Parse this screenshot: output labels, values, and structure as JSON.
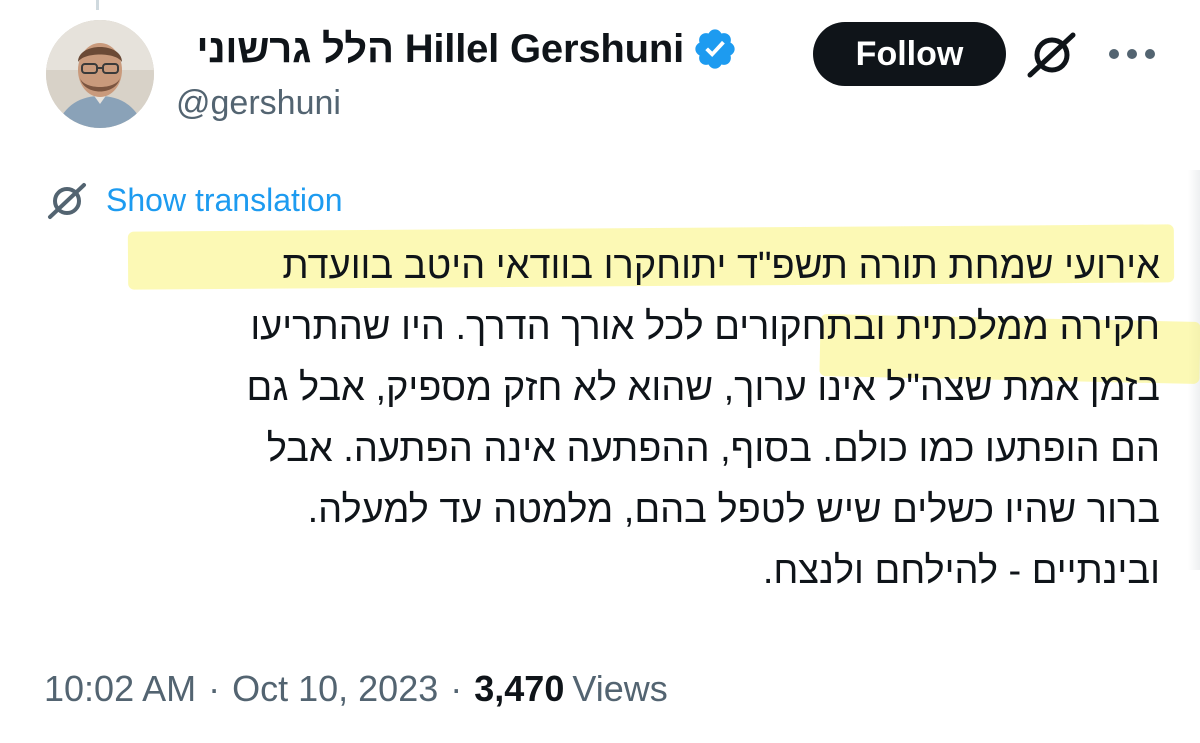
{
  "author": {
    "display_name": "הלל גרשוני Hillel Gershuni",
    "handle": "@gershuni",
    "verified": true,
    "avatar_icon": "person-photo"
  },
  "actions": {
    "follow_label": "Follow",
    "grok_icon": "grok-icon",
    "more_icon": "more-icon"
  },
  "translation": {
    "label": "Show translation",
    "icon": "grok-icon"
  },
  "tweet": {
    "lines": [
      "אירועי שמחת תורה תשפ\"ד יתוחקרו בוודאי היטב בוועדת",
      "חקירה ממלכתית ובתחקורים לכל אורך הדרך. היו שהתריעו",
      "בזמן אמת שצה\"ל אינו ערוך, שהוא לא חזק מספיק, אבל גם",
      "הם הופתעו כמו כולם. בסוף, ההפתעה אינה הפתעה. אבל",
      "ברור שהיו כשלים שיש לטפל בהם, מלמטה עד למעלה.",
      "ובינתיים - להילחם ולנצח."
    ]
  },
  "meta": {
    "time": "10:02 AM",
    "separator": "·",
    "date": "Oct 10, 2023",
    "views_count": "3,470",
    "views_label": "Views"
  },
  "colors": {
    "link": "#1d9bf0",
    "verified": "#1d9bf0",
    "highlight": "#faf478",
    "secondary_text": "#536471",
    "primary_text": "#0f1419"
  }
}
